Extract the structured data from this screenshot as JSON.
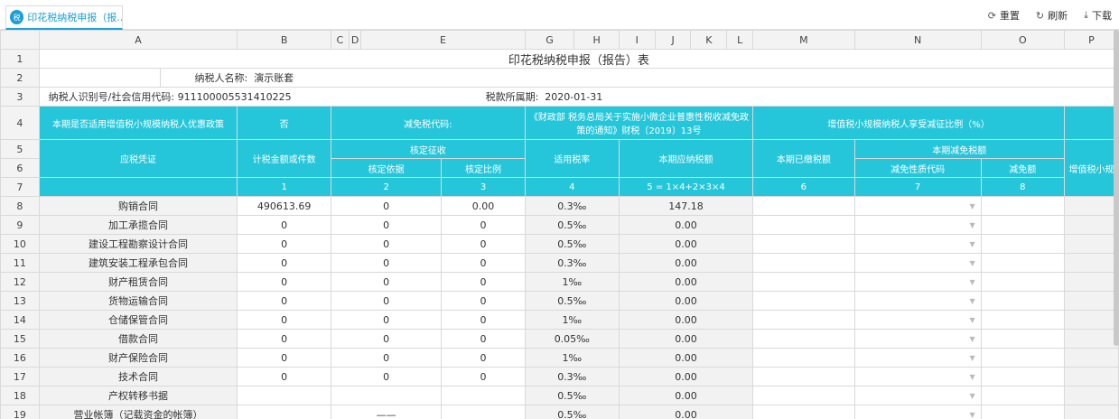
{
  "tab": {
    "icon": "report-icon",
    "label": "印花税纳税申报（报..."
  },
  "toolbar": {
    "reset": "重置",
    "refresh": "刷新",
    "download": "下载"
  },
  "columns": [
    "A",
    "B",
    "C",
    "D",
    "E",
    "F",
    "G",
    "H",
    "I",
    "J",
    "K",
    "L",
    "M",
    "N",
    "O",
    "P"
  ],
  "sheet": {
    "title": "印花税纳税申报（报告）表",
    "taxpayer_name_label": "纳税人名称:",
    "taxpayer_name": "演示账套",
    "taxpayer_id_label": "纳税人识别号/社会信用代码:",
    "taxpayer_id": "911100005531410225",
    "period_label": "税款所属期:",
    "period": "2020-01-31",
    "row4": {
      "policy_label": "本期是否适用增值税小规模纳税人优惠政策",
      "policy_value": "否",
      "exempt_code_label": "减免税代码:",
      "notice": "《财政部 税务总局关于实施小微企业普惠性税收减免政策的通知》财税〔2019〕13号",
      "ratio_label": "增值税小规模纳税人享受减征比例（%）"
    },
    "headers": {
      "tax_voucher": "应税凭证",
      "taxable_amount": "计税金额或件数",
      "assessed": "核定征收",
      "assessed_basis": "核定依据",
      "assessed_ratio": "核定比例",
      "rate": "适用税率",
      "payable": "本期应纳税额",
      "paid": "本期已缴税额",
      "relief": "本期减免税额",
      "relief_code": "减免性质代码",
      "relief_amount": "减免额",
      "small_scale": "增值税小规"
    },
    "index_row": [
      "1",
      "2",
      "3",
      "4",
      "5 = 1×4+2×3×4",
      "6",
      "7",
      "8"
    ],
    "rows": [
      {
        "n": "8",
        "name": "购销合同",
        "amount": "490613.69",
        "basis": "0",
        "ratio": "0.00",
        "rate": "0.3‰",
        "payable": "147.18"
      },
      {
        "n": "9",
        "name": "加工承揽合同",
        "amount": "0",
        "basis": "0",
        "ratio": "0",
        "rate": "0.5‰",
        "payable": "0.00"
      },
      {
        "n": "10",
        "name": "建设工程勘察设计合同",
        "amount": "0",
        "basis": "0",
        "ratio": "0",
        "rate": "0.5‰",
        "payable": "0.00"
      },
      {
        "n": "11",
        "name": "建筑安装工程承包合同",
        "amount": "0",
        "basis": "0",
        "ratio": "0",
        "rate": "0.3‰",
        "payable": "0.00"
      },
      {
        "n": "12",
        "name": "财产租赁合同",
        "amount": "0",
        "basis": "0",
        "ratio": "0",
        "rate": "1‰",
        "payable": "0.00"
      },
      {
        "n": "13",
        "name": "货物运输合同",
        "amount": "0",
        "basis": "0",
        "ratio": "0",
        "rate": "0.5‰",
        "payable": "0.00"
      },
      {
        "n": "14",
        "name": "仓储保管合同",
        "amount": "0",
        "basis": "0",
        "ratio": "0",
        "rate": "1‰",
        "payable": "0.00"
      },
      {
        "n": "15",
        "name": "借款合同",
        "amount": "0",
        "basis": "0",
        "ratio": "0",
        "rate": "0.05‰",
        "payable": "0.00"
      },
      {
        "n": "16",
        "name": "财产保险合同",
        "amount": "0",
        "basis": "0",
        "ratio": "0",
        "rate": "1‰",
        "payable": "0.00"
      },
      {
        "n": "17",
        "name": "技术合同",
        "amount": "0",
        "basis": "0",
        "ratio": "0",
        "rate": "0.3‰",
        "payable": "0.00"
      },
      {
        "n": "18",
        "name": "产权转移书据",
        "amount": "",
        "basis": "",
        "ratio": "",
        "rate": "0.5‰",
        "payable": "0.00"
      },
      {
        "n": "19",
        "name": "营业帐簿（记载资金的帐簿）",
        "amount": "",
        "basis": "——",
        "ratio": "",
        "rate": "0.5‰",
        "payable": "0.00"
      }
    ],
    "row_numbers": [
      "1",
      "2",
      "3",
      "4",
      "5",
      "6",
      "7"
    ]
  }
}
